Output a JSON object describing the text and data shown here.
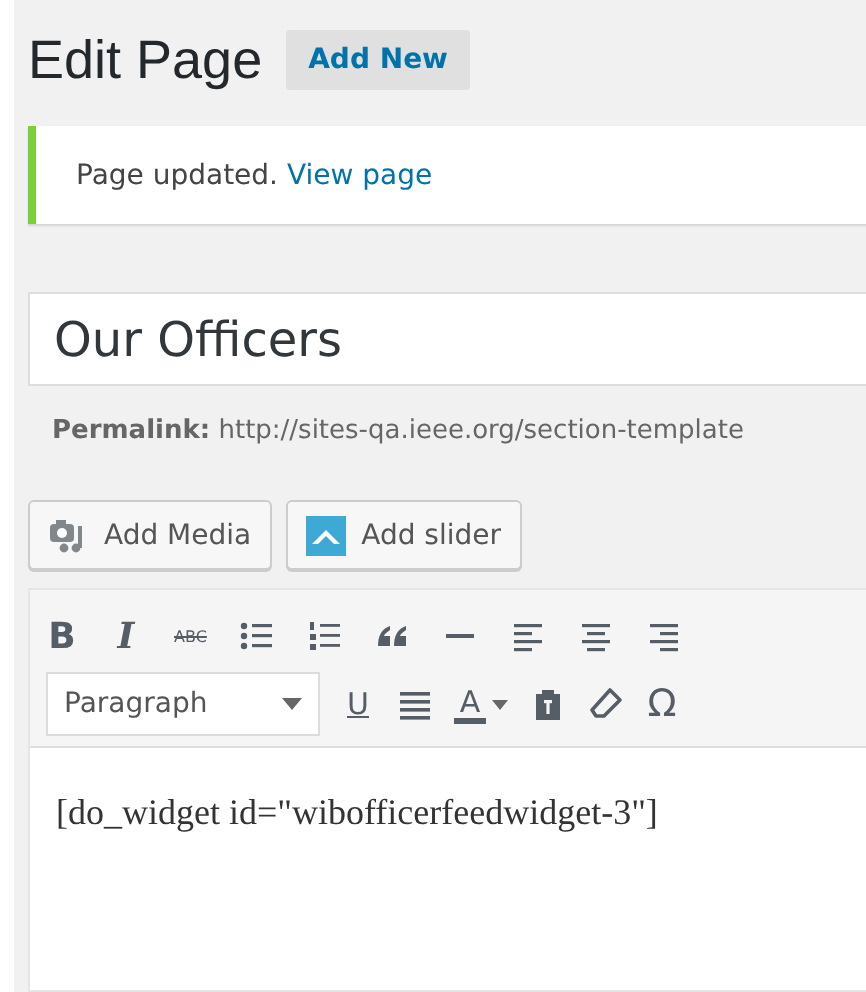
{
  "heading": {
    "title": "Edit Page",
    "add_new": "Add New"
  },
  "notice": {
    "message": "Page updated.",
    "link": "View page"
  },
  "post_title": {
    "value": "Our Officers"
  },
  "permalink": {
    "label": "Permalink:",
    "url": "http://sites-qa.ieee.org/section-template"
  },
  "media_buttons": [
    {
      "kind": "media",
      "label": "Add Media"
    },
    {
      "kind": "slider",
      "label": "Add slider"
    }
  ],
  "toolbar_rows": [
    [
      {
        "kind": "bold",
        "label": "B"
      },
      {
        "kind": "italic",
        "label": "I"
      },
      {
        "kind": "strike",
        "label": "ABC"
      },
      {
        "kind": "bullets"
      },
      {
        "kind": "numbers"
      },
      {
        "kind": "quote"
      },
      {
        "kind": "rule"
      },
      {
        "kind": "alignleft"
      },
      {
        "kind": "aligncenter"
      },
      {
        "kind": "alignright"
      }
    ],
    [
      {
        "kind": "format",
        "label": "Paragraph"
      },
      {
        "kind": "underline",
        "label": "U"
      },
      {
        "kind": "justify"
      },
      {
        "kind": "color",
        "label": "A"
      },
      {
        "kind": "paste"
      },
      {
        "kind": "eraser"
      },
      {
        "kind": "glyph",
        "label": "Ω"
      }
    ]
  ],
  "content": {
    "text": "[do_widget id=\"wibofficerfeedwidget-3\"]"
  }
}
